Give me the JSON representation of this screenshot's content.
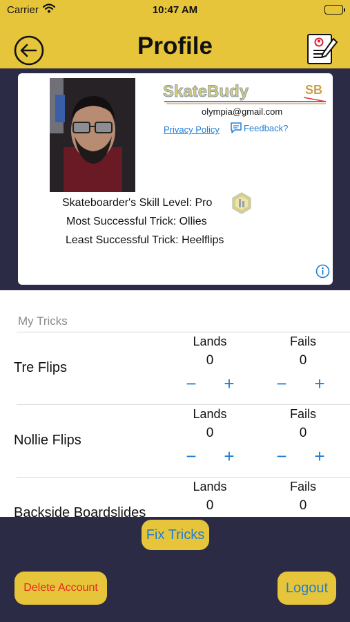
{
  "status_bar": {
    "carrier": "Carrier",
    "time": "10:47 AM"
  },
  "nav": {
    "title": "Profile",
    "back_icon": "back-arrow-circle-icon",
    "right_icon": "resume-edit-icon"
  },
  "profile": {
    "logo_text": "SkateBudy",
    "logo_mark": "SB",
    "email": "olympia@gmail.com",
    "privacy_link": "Privacy Policy",
    "feedback_link": "Feedback?",
    "skill_level": "Skateboarder's Skill Level: Pro",
    "most_successful": "Most Successful Trick: Ollies",
    "least_successful": "Least Successful Trick: Heelflips"
  },
  "tricks_section": {
    "header": "My Tricks",
    "lands_label": "Lands",
    "fails_label": "Fails",
    "minus_symbol": "−",
    "plus_symbol": "+",
    "items": [
      {
        "name": "Tre Flips",
        "lands": "0",
        "fails": "0"
      },
      {
        "name": "Nollie Flips",
        "lands": "0",
        "fails": "0"
      },
      {
        "name": "Backside Boardslides",
        "lands": "0",
        "fails": "0"
      }
    ]
  },
  "actions": {
    "fix_tricks": "Fix Tricks",
    "delete_account": "Delete Account",
    "logout": "Logout"
  },
  "colors": {
    "accent_yellow": "#e6c53b",
    "navy": "#2b2b45",
    "link_blue": "#1e7ed6",
    "danger_red": "#e8281c"
  }
}
